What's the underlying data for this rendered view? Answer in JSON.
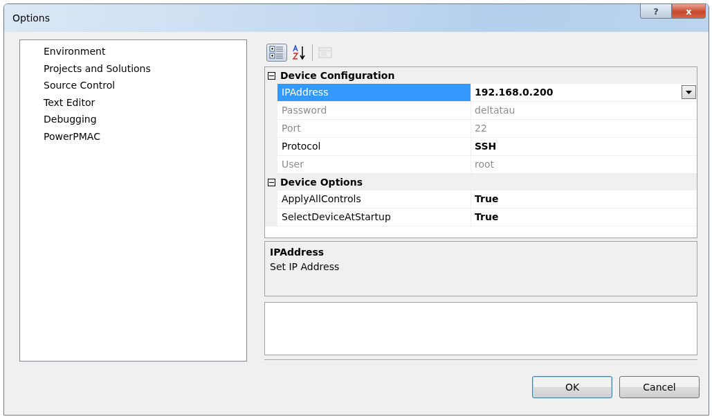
{
  "window": {
    "title": "Options"
  },
  "title_buttons": [
    {
      "kind": "help",
      "label": "?"
    },
    {
      "kind": "close",
      "label": "x"
    }
  ],
  "tree": {
    "items": [
      {
        "label": "Environment",
        "selected": false
      },
      {
        "label": "Projects and Solutions",
        "selected": false
      },
      {
        "label": "Source Control",
        "selected": false
      },
      {
        "label": "Text Editor",
        "selected": false
      },
      {
        "label": "Debugging",
        "selected": false
      },
      {
        "label": "PowerPMAC",
        "selected": false
      }
    ]
  },
  "toolbar": [
    {
      "kind": "categorized",
      "selected": true,
      "disabled": false
    },
    {
      "kind": "alphabetical",
      "selected": false,
      "disabled": false
    },
    {
      "kind": "property_pages",
      "selected": false,
      "disabled": true
    }
  ],
  "property_grid": {
    "categories": [
      {
        "name": "Device Configuration",
        "expanded": true,
        "properties": [
          {
            "name": "IPAddress",
            "value": "192.168.0.200",
            "selected": true,
            "readonly": false,
            "modified": true,
            "kind": "dropdown"
          },
          {
            "name": "Password",
            "value": "deltatau",
            "selected": false,
            "readonly": true,
            "modified": false,
            "kind": "text"
          },
          {
            "name": "Port",
            "value": "22",
            "selected": false,
            "readonly": true,
            "modified": false,
            "kind": "text"
          },
          {
            "name": "Protocol",
            "value": "SSH",
            "selected": false,
            "readonly": false,
            "modified": true,
            "kind": "text"
          },
          {
            "name": "User",
            "value": "root",
            "selected": false,
            "readonly": true,
            "modified": false,
            "kind": "text"
          }
        ]
      },
      {
        "name": "Device Options",
        "expanded": true,
        "properties": [
          {
            "name": "ApplyAllControls",
            "value": "True",
            "selected": false,
            "readonly": false,
            "modified": true,
            "kind": "text"
          },
          {
            "name": "SelectDeviceAtStartup",
            "value": "True",
            "selected": false,
            "readonly": false,
            "modified": true,
            "kind": "text"
          }
        ]
      }
    ]
  },
  "description": {
    "title": "IPAddress",
    "text": "Set IP Address"
  },
  "buttons": [
    {
      "label": "OK",
      "default": true
    },
    {
      "label": "Cancel",
      "default": false
    }
  ]
}
